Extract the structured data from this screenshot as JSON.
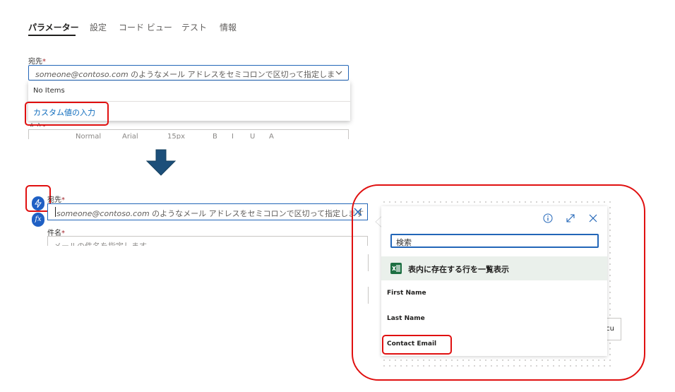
{
  "tabs": [
    {
      "label": "パラメーター",
      "active": true
    },
    {
      "label": "設定"
    },
    {
      "label": "コード ビュー"
    },
    {
      "label": "テスト"
    },
    {
      "label": "情報"
    }
  ],
  "upper": {
    "to_label": "宛先",
    "required_mark": "*",
    "to_placeholder_email": "someone@contoso.com",
    "to_placeholder_rest": " のようなメール アドレスをセミコロンで区切って指定しま",
    "dropdown": {
      "no_items": "No Items",
      "custom_value": "カスタム値の入力"
    },
    "body_label_partial": "本文",
    "toolbar_items": [
      "Normal",
      "Arial",
      "15px",
      "B",
      "I",
      "U",
      "A"
    ]
  },
  "lower": {
    "to_label": "宛先",
    "required_mark": "*",
    "to_placeholder_email": "someone@contoso.com",
    "to_placeholder_rest": " のようなメール アドレスをセミコロンで区切って指定します",
    "subject_label": "件名",
    "subject_placeholder_partial": "メールの件名を指定します",
    "fx_label": "fx"
  },
  "popup": {
    "search_placeholder": "検索",
    "action_label": "表内に存在する行を一覧表示",
    "items": [
      "First Name",
      "Last Name",
      "Contact Email"
    ],
    "behind_text": "ecu"
  },
  "colors": {
    "accent": "#0f6cbd",
    "highlight": "#e01010",
    "arrow": "#1c4f7a",
    "excel": "#1d6f42"
  }
}
